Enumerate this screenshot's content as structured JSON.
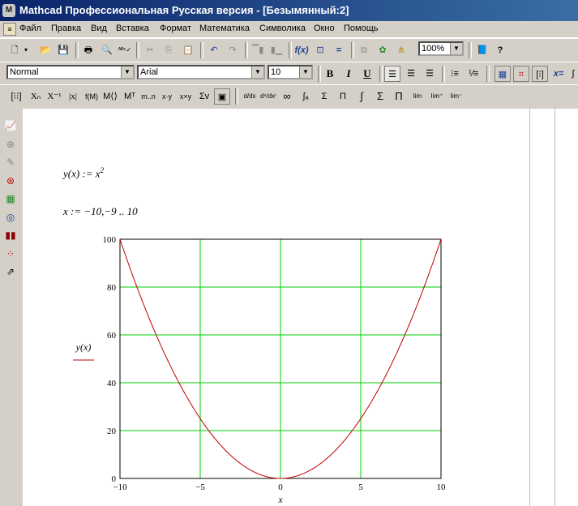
{
  "window": {
    "title": "Mathcad Профессиональная Русская версия - [Безымянный:2]"
  },
  "menu": [
    "Файл",
    "Правка",
    "Вид",
    "Вставка",
    "Формат",
    "Математика",
    "Символика",
    "Окно",
    "Помощь"
  ],
  "toolbar": {
    "zoom": "100%"
  },
  "format": {
    "style": "Normal",
    "font": "Arial",
    "size": "10"
  },
  "worksheet": {
    "definition": "y(x) := x",
    "definition_exponent": "2",
    "range": "x := −10,−9 .. 10",
    "plot_ylabel": "y(x)",
    "plot_xlabel": "x"
  },
  "chart_data": {
    "type": "line",
    "x": [
      -10,
      -9,
      -8,
      -7,
      -6,
      -5,
      -4,
      -3,
      -2,
      -1,
      0,
      1,
      2,
      3,
      4,
      5,
      6,
      7,
      8,
      9,
      10
    ],
    "series": [
      {
        "values": [
          100,
          81,
          64,
          49,
          36,
          25,
          16,
          9,
          4,
          1,
          0,
          1,
          4,
          9,
          16,
          25,
          36,
          49,
          64,
          81,
          100
        ],
        "color": "#c00000"
      }
    ],
    "xlim": [
      -10,
      10
    ],
    "ylim": [
      0,
      100
    ],
    "xticks": [
      -10,
      -5,
      0,
      5,
      10
    ],
    "yticks": [
      0,
      20,
      40,
      60,
      80,
      100
    ],
    "xtick_labels": [
      "−10",
      "−5",
      "0",
      "5",
      "10"
    ],
    "ytick_labels": [
      "0",
      "20",
      "40",
      "60",
      "80",
      "100"
    ],
    "grid": true,
    "grid_color": "#00cc00"
  }
}
